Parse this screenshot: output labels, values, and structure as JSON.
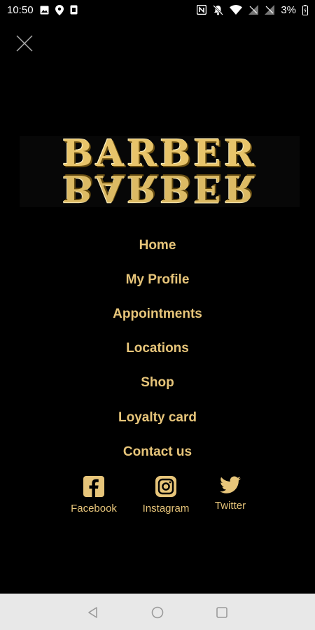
{
  "status_bar": {
    "time": "10:50",
    "battery": "3%",
    "left_icons": [
      "image-icon",
      "location-pin-icon",
      "sim-icon"
    ],
    "right_icons": [
      "nfc-icon",
      "mute-icon",
      "wifi-icon",
      "signal-icon",
      "signal-icon",
      "battery-icon"
    ]
  },
  "logo": {
    "text": "BARBER",
    "color": "#e8c46a"
  },
  "menu": {
    "items": [
      {
        "label": "Home"
      },
      {
        "label": "My Profile"
      },
      {
        "label": "Appointments"
      },
      {
        "label": "Locations"
      },
      {
        "label": "Shop"
      },
      {
        "label": "Loyalty card"
      },
      {
        "label": "Contact us"
      }
    ]
  },
  "socials": {
    "items": [
      {
        "label": "Facebook",
        "icon": "facebook-icon"
      },
      {
        "label": "Instagram",
        "icon": "instagram-icon"
      },
      {
        "label": "Twitter",
        "icon": "twitter-icon"
      }
    ]
  },
  "colors": {
    "background": "#000000",
    "accent": "#e7c57a",
    "nav_bar": "#e8e8e8"
  }
}
